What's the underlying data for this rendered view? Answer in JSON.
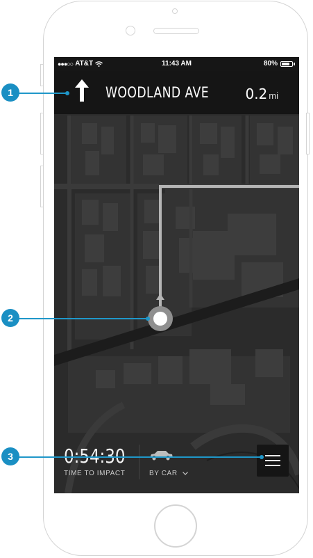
{
  "status_bar": {
    "signal": "●●●○○",
    "carrier": "AT&T",
    "time": "11:43 AM",
    "battery_text": "80%",
    "battery_level": 0.8
  },
  "navigation": {
    "turn_icon": "arrow-up-icon",
    "street": "WOODLAND AVE",
    "distance_value": "0.2",
    "distance_unit": "mi"
  },
  "trip": {
    "time_value": "0:54:30",
    "time_label": "TIME TO IMPACT",
    "mode_label": "BY CAR",
    "mode_icon": "car-icon",
    "menu_icon": "hamburger-menu-icon"
  },
  "callouts": [
    "1",
    "2",
    "3"
  ],
  "colors": {
    "callout": "#1a8fc3",
    "map_background": "#2b2b2b",
    "route": "#b5b5b5"
  }
}
